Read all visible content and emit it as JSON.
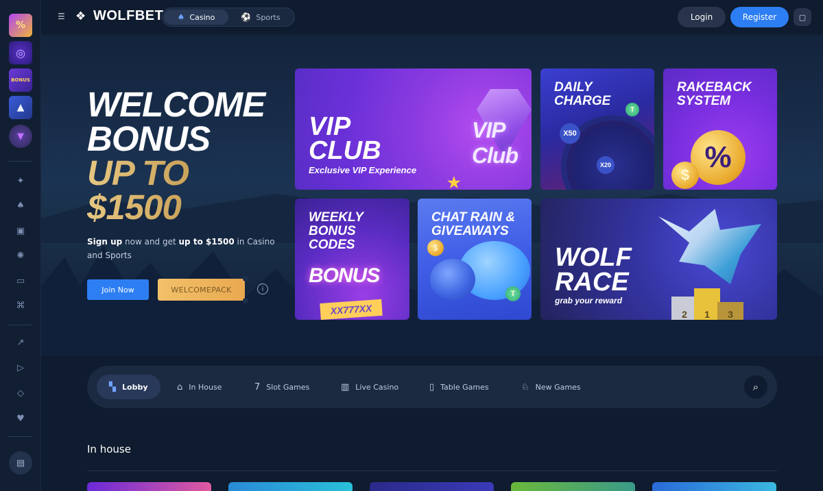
{
  "brand": {
    "name": "WOLFBET"
  },
  "topbar": {
    "mode_tabs": [
      {
        "label": "Casino",
        "icon": "spade-icon",
        "active": true
      },
      {
        "label": "Sports",
        "icon": "soccer-ball-icon",
        "active": false
      }
    ],
    "login_label": "Login",
    "register_label": "Register"
  },
  "sidebar": {
    "promos": [
      {
        "name": "rakeback-promo-thumb",
        "icon": "percent-icon"
      },
      {
        "name": "wheel-promo-thumb",
        "icon": "wheel-icon"
      },
      {
        "name": "bonus-promo-thumb",
        "label": "BONUS"
      },
      {
        "name": "wolf-race-promo-thumb",
        "icon": "wolf-icon"
      },
      {
        "name": "vip-promo-thumb",
        "icon": "gem-icon"
      }
    ],
    "nav_icons": [
      "wolf-icon",
      "spade-icon",
      "slot-machine-icon",
      "roulette-icon",
      "live-tv-icon",
      "gamepad-icon"
    ],
    "extra_icons": [
      "trending-icon",
      "ticket-icon",
      "gem-icon",
      "thumbs-up-icon"
    ]
  },
  "hero": {
    "line1": "WELCOME",
    "line2": "BONUS",
    "line3": "UP TO",
    "line4": "$1500",
    "sub_part1": "Sign up",
    "sub_part2": " now and get ",
    "sub_part3": "up to $1500",
    "sub_part4": " in Casino and Sports",
    "join_label": "Join Now",
    "promo_code": "WELCOMEPACK"
  },
  "promo_cards": {
    "vip": {
      "title_line1": "VIP",
      "title_line2": "CLUB",
      "subtitle": "Exclusive VIP Experience",
      "art_text": "VIP Club"
    },
    "daily": {
      "title_line1": "DAILY",
      "title_line2": "CHARGE",
      "badge1": "X50",
      "badge2": "X20"
    },
    "rakeback": {
      "title_line1": "RAKEBACK",
      "title_line2": "SYSTEM",
      "symbol": "%",
      "coin": "$"
    },
    "weekly": {
      "title_line1": "WEEKLY",
      "title_line2": "BONUS",
      "title_line3": "CODES",
      "art_text": "BONUS",
      "code": "XX777XX"
    },
    "chat": {
      "title_line1": "CHAT RAIN &",
      "title_line2": "GIVEAWAYS"
    },
    "wolf_race": {
      "title_line1": "WOLF",
      "title_line2": "RACE",
      "subtitle": "grab your reward",
      "places": [
        "2",
        "1",
        "3"
      ]
    }
  },
  "categories": [
    {
      "label": "Lobby",
      "icon": "lobby-icon",
      "active": true
    },
    {
      "label": "In House",
      "icon": "house-icon",
      "active": false
    },
    {
      "label": "Slot Games",
      "icon": "slot-icon",
      "active": false
    },
    {
      "label": "Live Casino",
      "icon": "live-casino-icon",
      "active": false
    },
    {
      "label": "Table Games",
      "icon": "cards-icon",
      "active": false
    },
    {
      "label": "New Games",
      "icon": "new-games-icon",
      "active": false
    }
  ],
  "section": {
    "title": "In house"
  },
  "colors": {
    "accent": "#2d7ef2",
    "gold": "#e7c782",
    "background": "#0f1b2e"
  }
}
